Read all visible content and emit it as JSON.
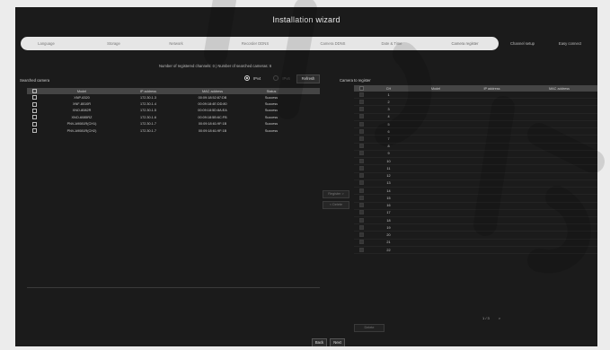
{
  "title": "Installation wizard",
  "steps": [
    {
      "label": "Language",
      "state": "done"
    },
    {
      "label": "Storage",
      "state": "done"
    },
    {
      "label": "Network",
      "state": "done"
    },
    {
      "label": "Recorder DDNS",
      "state": "done"
    },
    {
      "label": "Camera DDNS",
      "state": "done"
    },
    {
      "label": "Date & Time",
      "state": "done"
    },
    {
      "label": "Camera register",
      "state": "current"
    },
    {
      "label": "Channel setup",
      "state": "todo"
    },
    {
      "label": "Easy connect",
      "state": "todo"
    }
  ],
  "info_text": "Number of registered channels: 0 | Number of searched cameras: 6",
  "protocol": {
    "selected": "IPv4",
    "other": "IPv6"
  },
  "refresh_label": "Refresh",
  "searched": {
    "label": "Searched camera",
    "columns": [
      "Model",
      "IP address",
      "MAC address",
      "Status"
    ],
    "rows": [
      {
        "model": "XNP-6320",
        "ip": "172.30.1.3",
        "mac": "00:09:18:52:87:DB",
        "status": "Success"
      },
      {
        "model": "XNF-8010R",
        "ip": "172.30.1.4",
        "mac": "00:09:18:4E:DD:80",
        "status": "Success"
      },
      {
        "model": "XNO-8082R",
        "ip": "172.30.1.5",
        "mac": "00:09:18:5D:8A:EA",
        "status": "Success"
      },
      {
        "model": "XNO-6085RZ",
        "ip": "172.30.1.6",
        "mac": "00:09:18:5B:6C:FB",
        "status": "Success"
      },
      {
        "model": "PNV-A9081R(CH1)",
        "ip": "172.30.1.7",
        "mac": "00:09:18:61:9F:1B",
        "status": "Success"
      },
      {
        "model": "PNV-A9081R(CH2)",
        "ip": "172.30.1.7",
        "mac": "00:09:18:61:9F:1B",
        "status": "Success"
      }
    ]
  },
  "register_btn": "Register >",
  "unregister_btn": "< Delete",
  "registered": {
    "label": "Camera to register",
    "columns": [
      "CH",
      "Model",
      "IP address",
      "MAC address"
    ],
    "rows": [
      "1",
      "2",
      "3",
      "4",
      "5",
      "6",
      "7",
      "8",
      "9",
      "10",
      "11",
      "12",
      "13",
      "14",
      "15",
      "16",
      "17",
      "18",
      "19",
      "20",
      "21",
      "22"
    ]
  },
  "pagination": {
    "page": "1 / 3",
    "next": ">"
  },
  "delete_label": "Delete",
  "footer": {
    "back": "Back",
    "next": "Next"
  },
  "colors": {
    "background": "#1b1b1b",
    "header": "#454545",
    "step_done": "#e6e6e6"
  }
}
